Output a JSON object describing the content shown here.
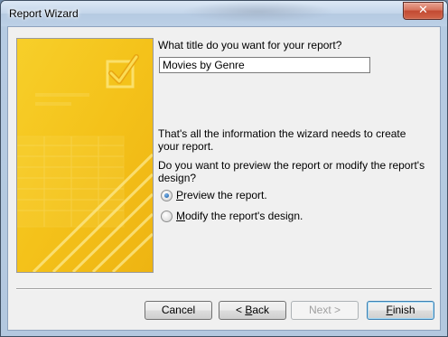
{
  "window": {
    "title": "Report Wizard",
    "close_glyph": "✕"
  },
  "art": {
    "icon": "checkbox-check-icon",
    "colors": {
      "primary": "#f4c21a",
      "light": "#fbe36a",
      "dark": "#e3a50c"
    }
  },
  "prompt": {
    "question": "What title do you want for your report?",
    "title_value": "Movies by Genre",
    "info": "That's all the information the wizard needs to create your report.",
    "preview_question": "Do you want to preview the report or modify the report's design?"
  },
  "options": [
    {
      "mnemonic": "P",
      "rest": "review the report.",
      "checked": true
    },
    {
      "mnemonic": "M",
      "rest": "odify the report's design.",
      "checked": false
    }
  ],
  "buttons": {
    "cancel": {
      "label": "Cancel"
    },
    "back": {
      "prefix": "< ",
      "mnemonic": "B",
      "rest": "ack"
    },
    "next": {
      "label": "Next >",
      "enabled": false
    },
    "finish": {
      "mnemonic": "F",
      "rest": "inish"
    }
  }
}
